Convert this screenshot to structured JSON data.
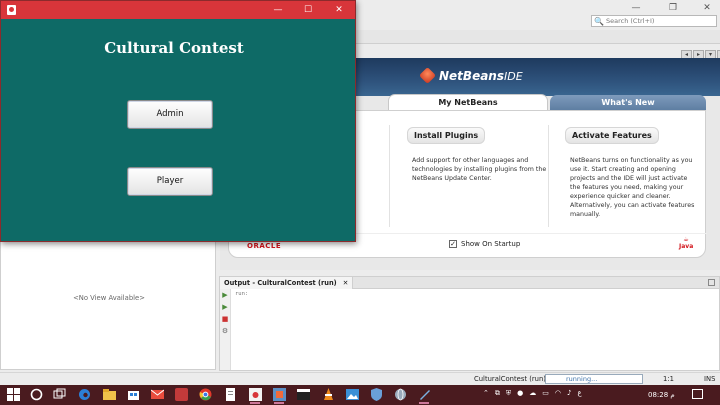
{
  "ide": {
    "search_placeholder": "Search (Ctrl+I)",
    "window_controls": {
      "minimize": "—",
      "restore": "❐",
      "close": "✕"
    },
    "tab_nav": [
      "◂",
      "▸",
      "▾",
      "▪"
    ]
  },
  "start_page": {
    "logo_name": "NetBeans",
    "logo_suffix": "IDE",
    "tabs": [
      {
        "label": "My NetBeans",
        "active": true
      },
      {
        "label": "What's New",
        "active": false
      }
    ],
    "columns": [
      {
        "heading": "Install Plugins",
        "text": "Add support for other languages and technologies by installing plugins from the NetBeans Update Center."
      },
      {
        "heading": "Activate Features",
        "text": "NetBeans turns on functionality as you use it. Start creating and opening projects and the IDE will just activate the features you need, making your experience quicker and cleaner. Alternatively, you can activate features manually."
      }
    ],
    "oracle_label": "ORACLE",
    "show_on_startup_label": "Show On Startup",
    "show_on_startup_checked": true,
    "java_label": "Java"
  },
  "navigator": {
    "empty_text": "<No View Available>"
  },
  "output": {
    "tab_label": "Output - CulturalContest (run)",
    "tab_close": "✕",
    "console_text": "run:"
  },
  "statusbar": {
    "project_label": "CulturalContest (run)",
    "running_label": "running...",
    "position": "1:1",
    "mode": "INS"
  },
  "taskbar": {
    "language": "ع",
    "clock": "08:28 م"
  },
  "app": {
    "window_controls": {
      "minimize": "—",
      "maximize": "☐",
      "close": "✕"
    },
    "heading": "Cultural Contest",
    "buttons": {
      "admin": "Admin",
      "player": "Player"
    },
    "colors": {
      "title_bar": "#d8353a",
      "background": "#0e6a66"
    }
  }
}
